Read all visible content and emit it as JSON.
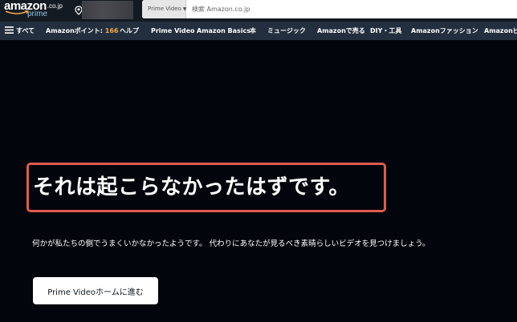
{
  "header": {
    "logo_text": "amazon",
    "logo_tld": ".co.jp",
    "logo_sub": "prime",
    "search": {
      "category": "Prime Video",
      "placeholder": "検索 Amazon.co.jp"
    }
  },
  "nav": {
    "menu_label": "すべて",
    "points_label": "Amazonポイント: ",
    "points_value": "166",
    "items": [
      "ヘルプ",
      "Prime Video",
      "Amazon Basics",
      "本",
      "ミュージック",
      "Amazonで売る",
      "DIY・工具",
      "Amazonファッション",
      "Amazonビジネス"
    ]
  },
  "main": {
    "heading": "それは起こらなかったはずです。",
    "message": "何かが私たちの側でうまくいかなかったようです。 代わりにあなたが見るべき素晴らしいビデオを見つけましょう。",
    "button_label": "Prime Videoホームに進む"
  },
  "colors": {
    "background": "#02050c",
    "top_bar": "#131a22",
    "nav_bar": "#232f3e",
    "points_accent": "#f3a847",
    "highlight_border": "#e05b4d",
    "button_bg": "#ffffff"
  }
}
